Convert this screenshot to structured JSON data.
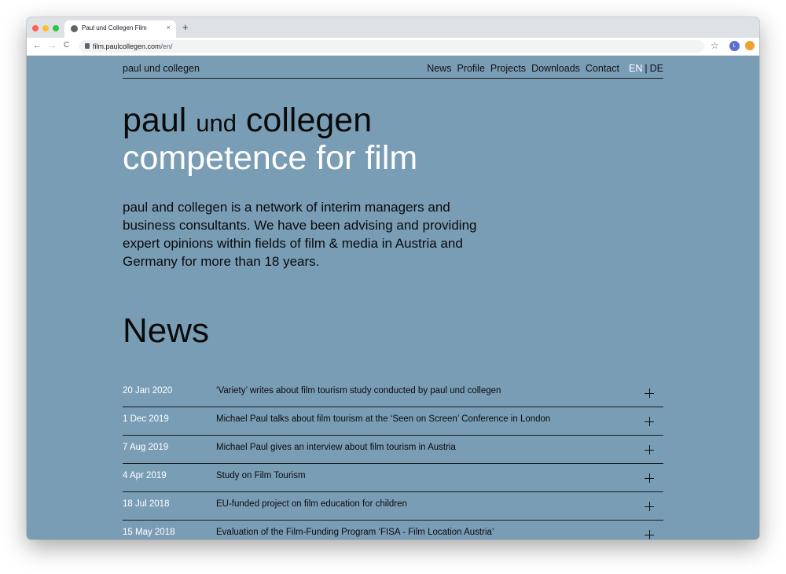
{
  "browser": {
    "tab_title": "Paul und Collegen Film",
    "tab_close": "×",
    "new_tab": "+",
    "url_host": "film.paulcollegen.com",
    "url_path": "/en/",
    "back": "←",
    "forward": "→",
    "reload": "C",
    "star": "☆",
    "profile_initial": "L"
  },
  "header": {
    "logo": "paul und collegen",
    "nav": [
      "News",
      "Profile",
      "Projects",
      "Downloads",
      "Contact"
    ],
    "lang_en": "EN",
    "lang_sep": "|",
    "lang_de": "DE"
  },
  "hero": {
    "title_part1": "paul ",
    "title_part2": "und",
    "title_part3": " collegen",
    "subtitle": "competence for film"
  },
  "intro": "paul and collegen is a network of interim managers and business consultants. We have been advising and providing expert opinions within fields of film & media in Austria and Germany for more than 18 years.",
  "news": {
    "heading": "News",
    "items": [
      {
        "date": "20 Jan 2020",
        "text": "‘Variety’ writes about film tourism study conducted by paul und collegen"
      },
      {
        "date": "1 Dec 2019",
        "text": "Michael Paul talks about film tourism at the ‘Seen on Screen’ Conference in London"
      },
      {
        "date": "7 Aug 2019",
        "text": "Michael Paul gives an interview about film tourism in Austria"
      },
      {
        "date": "4 Apr 2019",
        "text": "Study on Film Tourism"
      },
      {
        "date": "18 Jul 2018",
        "text": "EU-funded project on film education for children"
      },
      {
        "date": "15 May 2018",
        "text": "Evaluation of the Film-Funding Program ‘FISA - Film Location Austria’"
      }
    ]
  },
  "colors": {
    "page_bg": "#7a9db6",
    "accent_white": "#ffffff",
    "text_dark": "#0a0a0a"
  }
}
